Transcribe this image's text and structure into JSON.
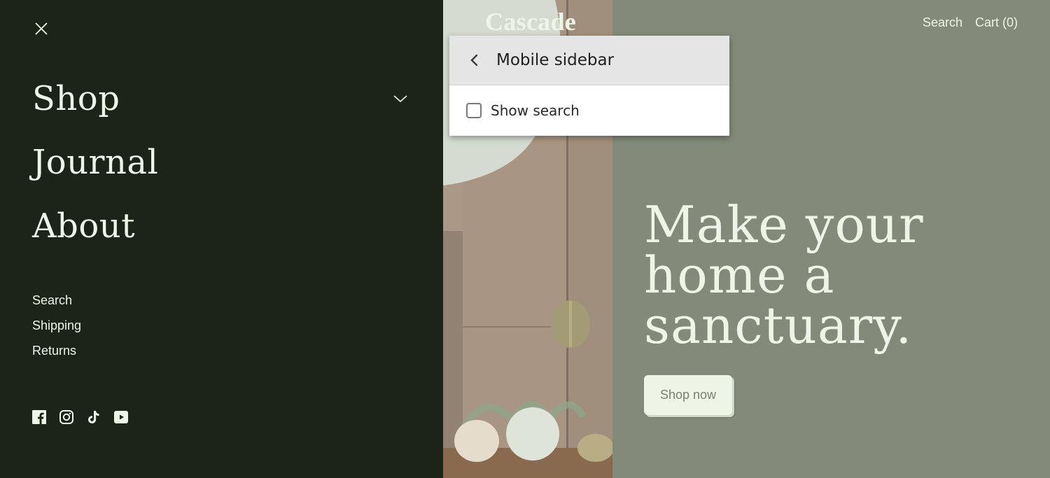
{
  "drawer": {
    "close_label": "Close menu",
    "main_nav": [
      {
        "label": "Shop",
        "has_dropdown": true
      },
      {
        "label": "Journal",
        "has_dropdown": false
      },
      {
        "label": "About",
        "has_dropdown": false
      }
    ],
    "secondary_nav": [
      "Search",
      "Shipping",
      "Returns"
    ],
    "social_icons": [
      "facebook-icon",
      "instagram-icon",
      "tiktok-icon",
      "youtube-icon"
    ]
  },
  "header": {
    "logo": "Cascade",
    "search_label": "Search",
    "cart_label": "Cart (0)"
  },
  "hero": {
    "headline": "Make your home a sanctuary.",
    "cta_label": "Shop now"
  },
  "popup": {
    "title": "Mobile sidebar",
    "checkbox_label": "Show search",
    "checkbox_checked": false
  },
  "colors": {
    "drawer_bg": "#1b2416",
    "hero_bg": "#838a7a",
    "text_light": "#eef4e6",
    "popup_header_bg": "#e5e5e5"
  }
}
